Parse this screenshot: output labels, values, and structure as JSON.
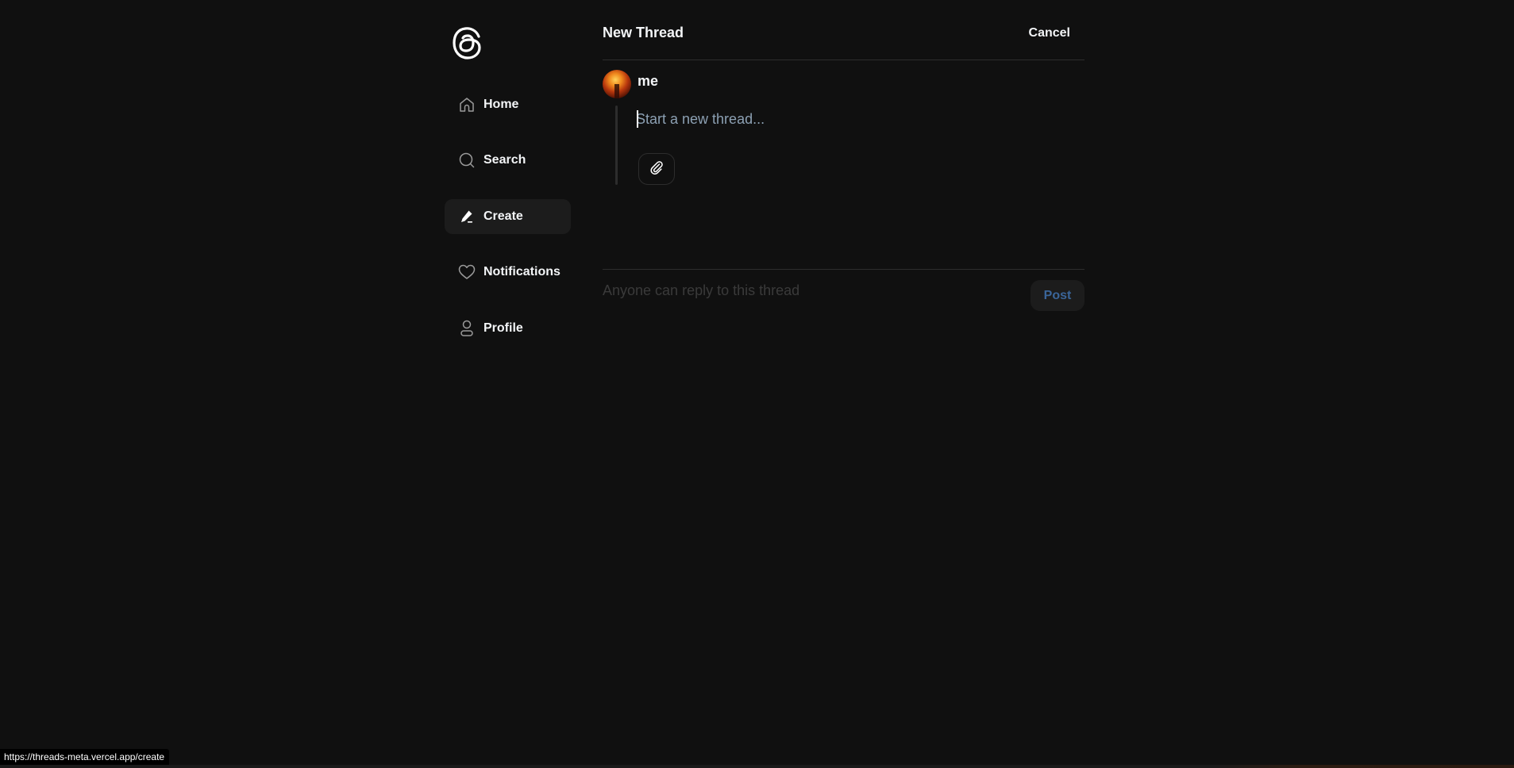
{
  "app": {
    "logo": "threads-logo"
  },
  "sidebar": {
    "items": [
      {
        "label": "Home",
        "icon": "home-icon",
        "active": false
      },
      {
        "label": "Search",
        "icon": "search-icon",
        "active": false
      },
      {
        "label": "Create",
        "icon": "pencil-icon",
        "active": true
      },
      {
        "label": "Notifications",
        "icon": "heart-icon",
        "active": false
      },
      {
        "label": "Profile",
        "icon": "user-icon",
        "active": false
      }
    ]
  },
  "header": {
    "title": "New Thread",
    "cancel_label": "Cancel"
  },
  "composer": {
    "username": "me",
    "value": "",
    "placeholder": "Start a new thread...",
    "attach_icon": "paperclip-icon"
  },
  "footer": {
    "reply_hint": "Anyone can reply to this thread",
    "post_label": "Post"
  },
  "status_bar": {
    "url": "https://threads-meta.vercel.app/create"
  },
  "colors": {
    "background": "#101010",
    "text": "#f3f5f7",
    "active_nav_bg": "#1c1c1c",
    "divider": "#2d2d2d",
    "placeholder": "#8ca0b3",
    "post_disabled_text": "#3a6599"
  }
}
